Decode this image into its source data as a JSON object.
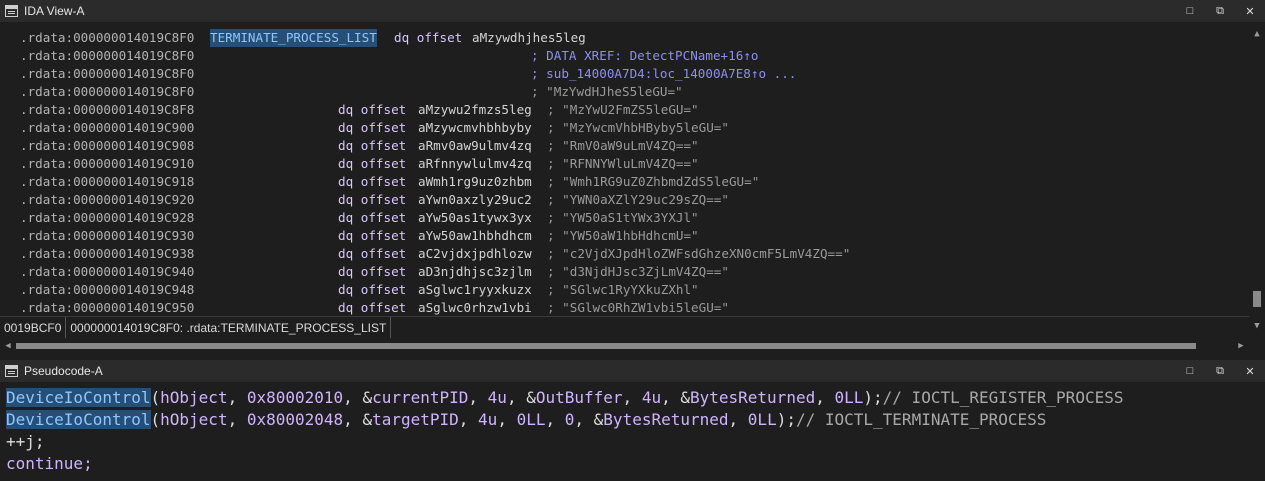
{
  "ida_view": {
    "title": "IDA View-A",
    "rows": [
      {
        "seg": ".rdata:000000014019C8F0",
        "sym": "TERMINATE_PROCESS_LIST",
        "mn": "dq offset",
        "lbl": "aMzywdhjhes5leg",
        "cmt": "",
        "str": ""
      },
      {
        "seg": ".rdata:000000014019C8F0",
        "sym": "",
        "mn": "",
        "lbl": "",
        "cmt": "; DATA XREF: DetectPCName+16↑o",
        "str": ""
      },
      {
        "seg": ".rdata:000000014019C8F0",
        "sym": "",
        "mn": "",
        "lbl": "",
        "cmt": "; sub_14000A7D4:loc_14000A7E8↑o ...",
        "str": ""
      },
      {
        "seg": ".rdata:000000014019C8F0",
        "sym": "",
        "mn": "",
        "lbl": "",
        "cmt": "",
        "str": "; \"MzYwdHJheS5leGU=\""
      },
      {
        "seg": ".rdata:000000014019C8F8",
        "sym": "",
        "mn": "dq offset",
        "lbl": "aMzywu2fmzs5leg",
        "cmt": "",
        "str": "; \"MzYwU2FmZS5leGU=\""
      },
      {
        "seg": ".rdata:000000014019C900",
        "sym": "",
        "mn": "dq offset",
        "lbl": "aMzywcmvhbhbyby",
        "cmt": "",
        "str": "; \"MzYwcmVhbHByby5leGU=\""
      },
      {
        "seg": ".rdata:000000014019C908",
        "sym": "",
        "mn": "dq offset",
        "lbl": "aRmv0aw9ulmv4zq",
        "cmt": "",
        "str": "; \"RmV0aW9uLmV4ZQ==\""
      },
      {
        "seg": ".rdata:000000014019C910",
        "sym": "",
        "mn": "dq offset",
        "lbl": "aRfnnywlulmv4zq",
        "cmt": "",
        "str": "; \"RFNNYWluLmV4ZQ==\""
      },
      {
        "seg": ".rdata:000000014019C918",
        "sym": "",
        "mn": "dq offset",
        "lbl": "aWmh1rg9uz0zhbm",
        "cmt": "",
        "str": "; \"Wmh1RG9uZ0ZhbmdZdS5leGU=\""
      },
      {
        "seg": ".rdata:000000014019C920",
        "sym": "",
        "mn": "dq offset",
        "lbl": "aYwn0axzly29uc2",
        "cmt": "",
        "str": "; \"YWN0aXZlY29uc29sZQ==\""
      },
      {
        "seg": ".rdata:000000014019C928",
        "sym": "",
        "mn": "dq offset",
        "lbl": "aYw50as1tywx3yx",
        "cmt": "",
        "str": "; \"YW50aS1tYWx3YXJl\""
      },
      {
        "seg": ".rdata:000000014019C930",
        "sym": "",
        "mn": "dq offset",
        "lbl": "aYw50aw1hbhdhcm",
        "cmt": "",
        "str": "; \"YW50aW1hbHdhcmU=\""
      },
      {
        "seg": ".rdata:000000014019C938",
        "sym": "",
        "mn": "dq offset",
        "lbl": "aC2vjdxjpdhlozw",
        "cmt": "",
        "str": "; \"c2VjdXJpdHloZWFsdGhzeXN0cmF5LmV4ZQ==\""
      },
      {
        "seg": ".rdata:000000014019C940",
        "sym": "",
        "mn": "dq offset",
        "lbl": "aD3njdhjsc3zjlm",
        "cmt": "",
        "str": "; \"d3NjdHJsc3ZjLmV4ZQ==\""
      },
      {
        "seg": ".rdata:000000014019C948",
        "sym": "",
        "mn": "dq offset",
        "lbl": "aSglwc1ryyxkuzx",
        "cmt": "",
        "str": "; \"SGlwc1RyYXkuZXhl\""
      },
      {
        "seg": ".rdata:000000014019C950",
        "sym": "",
        "mn": "dq offset",
        "lbl": "aSglwc0rhzw1vbi",
        "cmt": "",
        "str": "; \"SGlwc0RhZW1vbi5leGU=\""
      }
    ],
    "status": {
      "offset": "0019BCF0",
      "location": "000000014019C8F0: .rdata:TERMINATE_PROCESS_LIST"
    }
  },
  "pseudocode": {
    "title": "Pseudocode-A",
    "lines": [
      {
        "fn": "DeviceIoControl",
        "p1": "(",
        "hobj": "hObject",
        "c1": ", ",
        "code": "0x80002010",
        "c2": ", &",
        "v1": "currentPID",
        "c3": ", ",
        "n1": "4u",
        "c4": ", &",
        "v2": "OutBuffer",
        "c5": ", ",
        "n2": "4u",
        "c6": ", &",
        "v3": "BytesReturned",
        "c7": ", ",
        "n3": "0LL",
        "c8": ");",
        "cmt": "// IOCTL_REGISTER_PROCESS"
      },
      {
        "fn": "DeviceIoControl",
        "p1": "(",
        "hobj": "hObject",
        "c1": ", ",
        "code": "0x80002048",
        "c2": ", &",
        "v1": "targetPID",
        "c3": ", ",
        "n1": "4u",
        "c4": ", ",
        "v2": "0LL",
        "c5": ", ",
        "n2": "0",
        "c6": ", &",
        "v3": "BytesReturned",
        "c7": ", ",
        "n3": "0LL",
        "c8": ");",
        "cmt": "// IOCTL_TERMINATE_PROCESS"
      }
    ],
    "line3": "++j;",
    "line4": "continue;"
  },
  "window_controls": {
    "restore": "□",
    "float": "⧉",
    "close": "✕"
  },
  "icons": [
    "window-icon",
    "restore-icon",
    "float-icon",
    "close-icon",
    "scroll-up-icon",
    "scroll-down-icon",
    "scroll-left-icon",
    "scroll-right-icon"
  ]
}
